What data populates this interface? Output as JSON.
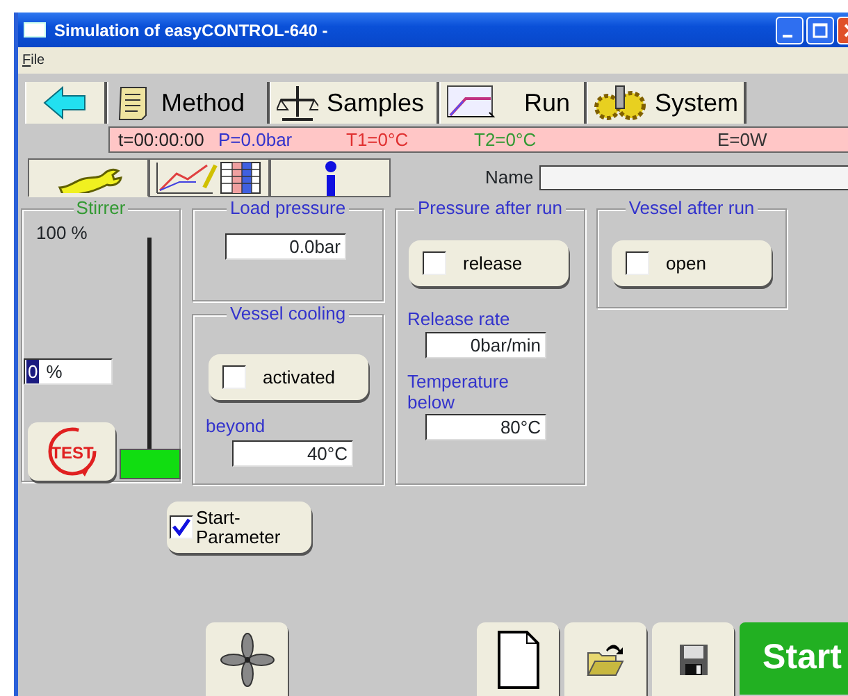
{
  "window": {
    "title": "Simulation of easyCONTROL-640 -"
  },
  "menu": [
    {
      "label": "File"
    }
  ],
  "main_tabs": [
    {
      "kind": "back",
      "selected": false
    },
    {
      "kind": "method",
      "label": "Method",
      "selected": true
    },
    {
      "kind": "samples",
      "label": "Samples",
      "selected": false
    },
    {
      "kind": "run",
      "label": "Run",
      "selected": false
    },
    {
      "kind": "system",
      "label": "System",
      "selected": false
    }
  ],
  "status": [
    {
      "text": "t=00:00:00",
      "color": "#222222"
    },
    {
      "text": "P=0.0bar",
      "color": "#3333cc"
    },
    {
      "text": "T1=0°C",
      "color": "#e03030"
    },
    {
      "text": "T2=0°C",
      "color": "#339933"
    },
    {
      "text": "E=0W",
      "color": "#333333"
    }
  ],
  "sub_tabs": [
    {
      "kind": "settings",
      "selected": true
    },
    {
      "kind": "chart",
      "selected": false
    },
    {
      "kind": "info",
      "selected": false
    }
  ],
  "name_field": {
    "label": "Name"
  },
  "stirrer": {
    "title": "Stirrer",
    "max_label": "100 %",
    "value": "0",
    "unit": "%",
    "level": 0,
    "test_label": "TEST"
  },
  "load_pressure": {
    "title": "Load pressure",
    "value": "0.0bar"
  },
  "vessel_cooling": {
    "title": "Vessel cooling",
    "toggle": {
      "label": "activated",
      "checked": false
    },
    "beyond_label": "beyond",
    "value": "40°C"
  },
  "pressure_after_run": {
    "title": "Pressure after run",
    "toggle": {
      "label": "release",
      "checked": false
    },
    "rate_label": "Release rate",
    "rate_value": "0bar/min",
    "temp_label": "Temperature below",
    "temp_value": "80°C"
  },
  "vessel_after_run": {
    "title": "Vessel after run",
    "toggle": {
      "label": "open",
      "checked": false
    }
  },
  "start_parameter": {
    "label": "Start-Parameter",
    "checked": true
  },
  "toolbar": [
    {
      "kind": "fan"
    },
    {
      "kind": "new"
    },
    {
      "kind": "open"
    },
    {
      "kind": "save"
    },
    {
      "kind": "start",
      "label": "Start"
    }
  ]
}
